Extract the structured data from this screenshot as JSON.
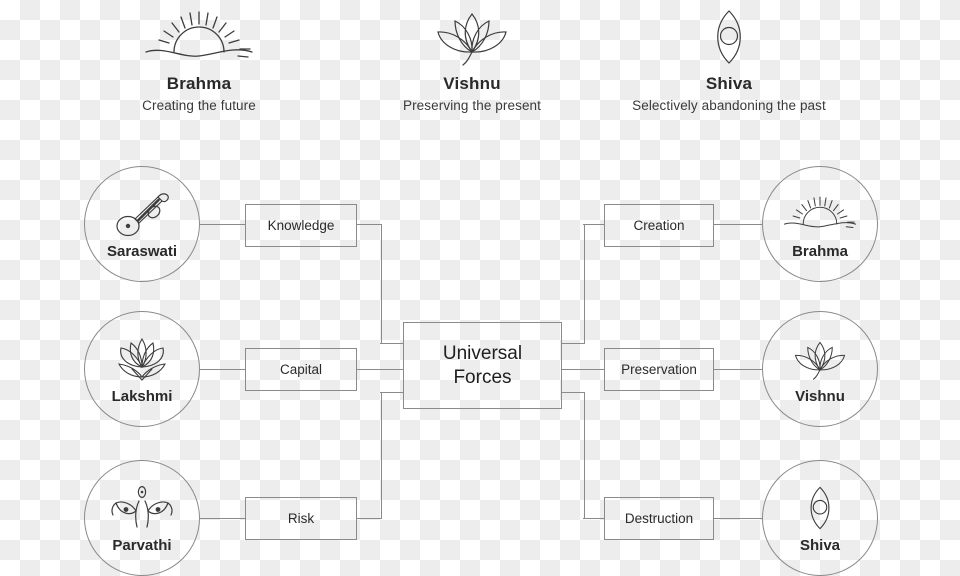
{
  "legend": {
    "items": [
      {
        "icon": "sunrise-icon",
        "name": "Brahma",
        "subtitle": "Creating the future"
      },
      {
        "icon": "lotus-icon",
        "name": "Vishnu",
        "subtitle": "Preserving the present"
      },
      {
        "icon": "third-eye-icon",
        "name": "Shiva",
        "subtitle": "Selectively abandoning the past"
      }
    ]
  },
  "diagram": {
    "center": {
      "label": "Universal\nForces",
      "line1": "Universal",
      "line2": "Forces"
    },
    "left_nodes": [
      {
        "icon": "veena-icon",
        "name": "Saraswati"
      },
      {
        "icon": "lotus-icon",
        "name": "Lakshmi"
      },
      {
        "icon": "goddess-eyes-icon",
        "name": "Parvathi"
      }
    ],
    "left_boxes": [
      {
        "label": "Knowledge"
      },
      {
        "label": "Capital"
      },
      {
        "label": "Risk"
      }
    ],
    "right_boxes": [
      {
        "label": "Creation"
      },
      {
        "label": "Preservation"
      },
      {
        "label": "Destruction"
      }
    ],
    "right_nodes": [
      {
        "icon": "sunrise-icon",
        "name": "Brahma"
      },
      {
        "icon": "lotus-icon",
        "name": "Vishnu"
      },
      {
        "icon": "third-eye-icon",
        "name": "Shiva"
      }
    ]
  },
  "colors": {
    "stroke": "#8a8a8a",
    "icon_stroke": "#3c3c3c",
    "text": "#2a2a2a",
    "checker_light": "#ffffff",
    "checker_dark": "#ededed"
  }
}
